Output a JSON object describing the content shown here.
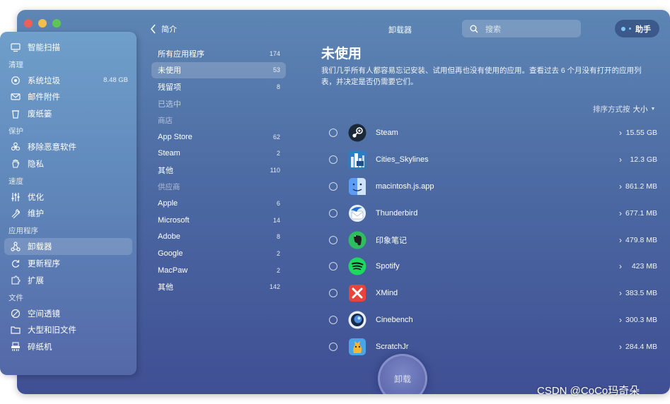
{
  "window": {
    "title": "卸载器"
  },
  "toolbar": {
    "back_label": "简介",
    "search_placeholder": "搜索",
    "assistant_label": "助手"
  },
  "sidebar": {
    "items": [
      {
        "label": "智能扫描",
        "icon": "monitor-icon"
      },
      {
        "section": "清理"
      },
      {
        "label": "系统垃圾",
        "value": "8.48 GB",
        "icon": "recycle-icon"
      },
      {
        "label": "邮件附件",
        "icon": "mail-icon"
      },
      {
        "label": "废纸篓",
        "icon": "trash-icon"
      },
      {
        "section": "保护"
      },
      {
        "label": "移除恶意软件",
        "icon": "biohazard-icon"
      },
      {
        "label": "隐私",
        "icon": "hand-icon"
      },
      {
        "section": "速度"
      },
      {
        "label": "优化",
        "icon": "sliders-icon"
      },
      {
        "label": "维护",
        "icon": "wrench-icon"
      },
      {
        "section": "应用程序"
      },
      {
        "label": "卸载器",
        "icon": "uninstaller-icon",
        "active": true
      },
      {
        "label": "更新程序",
        "icon": "update-icon"
      },
      {
        "label": "扩展",
        "icon": "extension-icon"
      },
      {
        "section": "文件"
      },
      {
        "label": "空间透镜",
        "icon": "lens-icon"
      },
      {
        "label": "大型和旧文件",
        "icon": "folder-icon"
      },
      {
        "label": "碎纸机",
        "icon": "shredder-icon"
      }
    ]
  },
  "filters": {
    "items": [
      {
        "label": "所有应用程序",
        "count": "174"
      },
      {
        "label": "未使用",
        "count": "53",
        "active": true
      },
      {
        "label": "残留项",
        "count": "8"
      },
      {
        "label": "已选中",
        "count": "",
        "dim": true
      },
      {
        "section": "商店"
      },
      {
        "label": "App Store",
        "count": "62"
      },
      {
        "label": "Steam",
        "count": "2"
      },
      {
        "label": "其他",
        "count": "110"
      },
      {
        "section": "供应商"
      },
      {
        "label": "Apple",
        "count": "6"
      },
      {
        "label": "Microsoft",
        "count": "14"
      },
      {
        "label": "Adobe",
        "count": "8"
      },
      {
        "label": "Google",
        "count": "2"
      },
      {
        "label": "MacPaw",
        "count": "2"
      },
      {
        "label": "其他",
        "count": "142"
      }
    ]
  },
  "main": {
    "title": "未使用",
    "description": "我们几乎所有人都容易忘记安装、试用但再也没有使用的应用。查看过去 6 个月没有打开的应用列表，并决定是否仍需要它们。",
    "sort_label": "排序方式按",
    "sort_value": "大小",
    "apps": [
      {
        "name": "Steam",
        "size": "15.55 GB",
        "icon": "steam-icon"
      },
      {
        "name": "Cities_Skylines",
        "size": "12.3 GB",
        "icon": "cities-skylines-icon"
      },
      {
        "name": "macintosh.js.app",
        "size": "861.2 MB",
        "icon": "finder-icon"
      },
      {
        "name": "Thunderbird",
        "size": "677.1 MB",
        "icon": "thunderbird-icon"
      },
      {
        "name": "印象笔记",
        "size": "479.8 MB",
        "icon": "evernote-icon"
      },
      {
        "name": "Spotify",
        "size": "423 MB",
        "icon": "spotify-icon"
      },
      {
        "name": "XMind",
        "size": "383.5 MB",
        "icon": "xmind-icon"
      },
      {
        "name": "Cinebench",
        "size": "300.3 MB",
        "icon": "cinebench-icon"
      },
      {
        "name": "ScratchJr",
        "size": "284.4 MB",
        "icon": "scratchjr-icon"
      }
    ],
    "uninstall_label": "卸载"
  },
  "watermark": "CSDN @CoCo玛奇朵",
  "colors": {
    "accent": "#4c6aa3",
    "sidebar": "#6f9fca"
  }
}
